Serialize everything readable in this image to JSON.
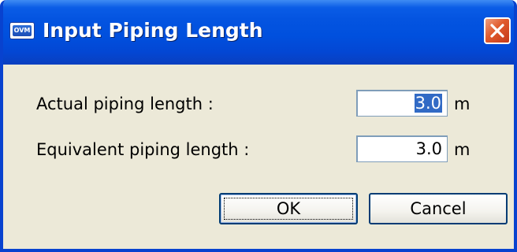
{
  "window": {
    "title": "Input Piping Length",
    "app_icon_text": "OVM",
    "close_icon": "close-x-icon"
  },
  "form": {
    "actual": {
      "label": "Actual piping length :",
      "value": "3.0",
      "unit": "m"
    },
    "equivalent": {
      "label": "Equivalent piping length :",
      "value": "3.0",
      "unit": "m"
    }
  },
  "buttons": {
    "ok": "OK",
    "cancel": "Cancel"
  },
  "colors": {
    "titlebar": "#0050de",
    "dialog_bg": "#ece9d8",
    "close_button": "#e05a2c",
    "selection": "#316ac5",
    "field_border": "#7f9db9"
  }
}
